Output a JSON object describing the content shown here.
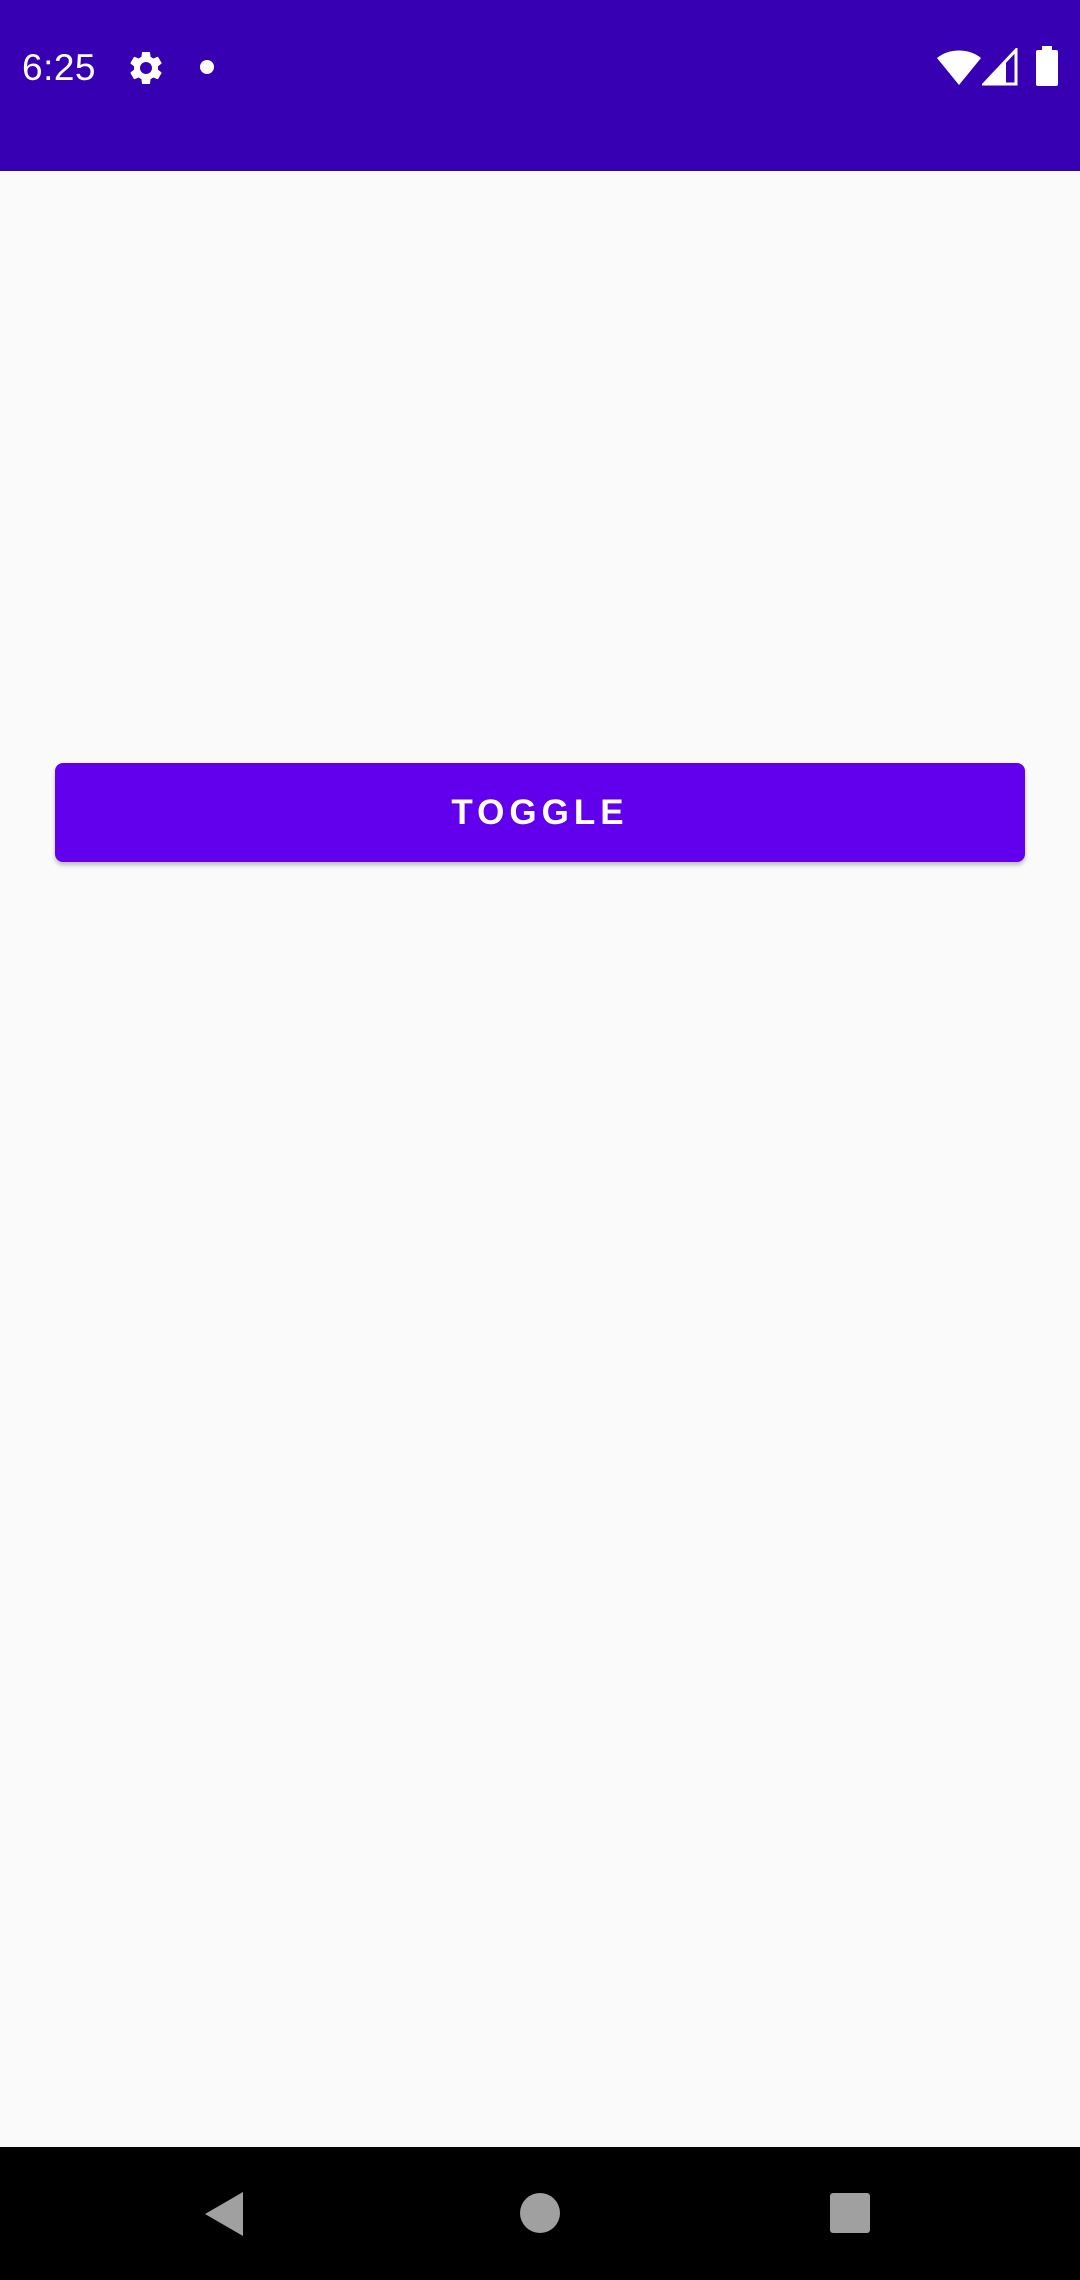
{
  "status_bar": {
    "time": "6:25",
    "background_color": "#3700b3",
    "icons": [
      "gear-icon",
      "notification-dot-icon",
      "wifi-icon",
      "cell-signal-icon",
      "battery-icon"
    ]
  },
  "main": {
    "toggle_button_label": "TOGGLE",
    "button_color": "#6200ee",
    "background_color": "#fafafa"
  },
  "nav_bar": {
    "buttons": [
      "back-icon",
      "home-icon",
      "recents-icon"
    ]
  }
}
